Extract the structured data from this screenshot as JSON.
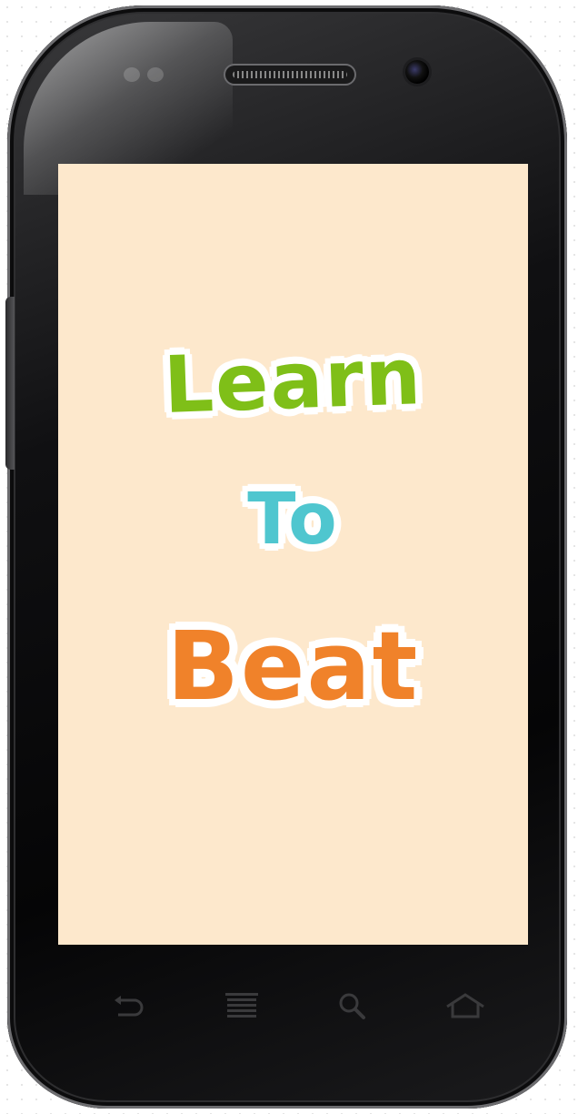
{
  "splash": {
    "word_learn": "Learn",
    "word_to": "To",
    "word_beat": "Beat"
  },
  "colors": {
    "screen_background": "#fde8cc",
    "learn": "#7fbf18",
    "to": "#4fc6cf",
    "beat": "#f0822a",
    "outline": "#ffffff"
  },
  "nav_icons": [
    "back-icon",
    "menu-icon",
    "search-icon",
    "home-icon"
  ]
}
